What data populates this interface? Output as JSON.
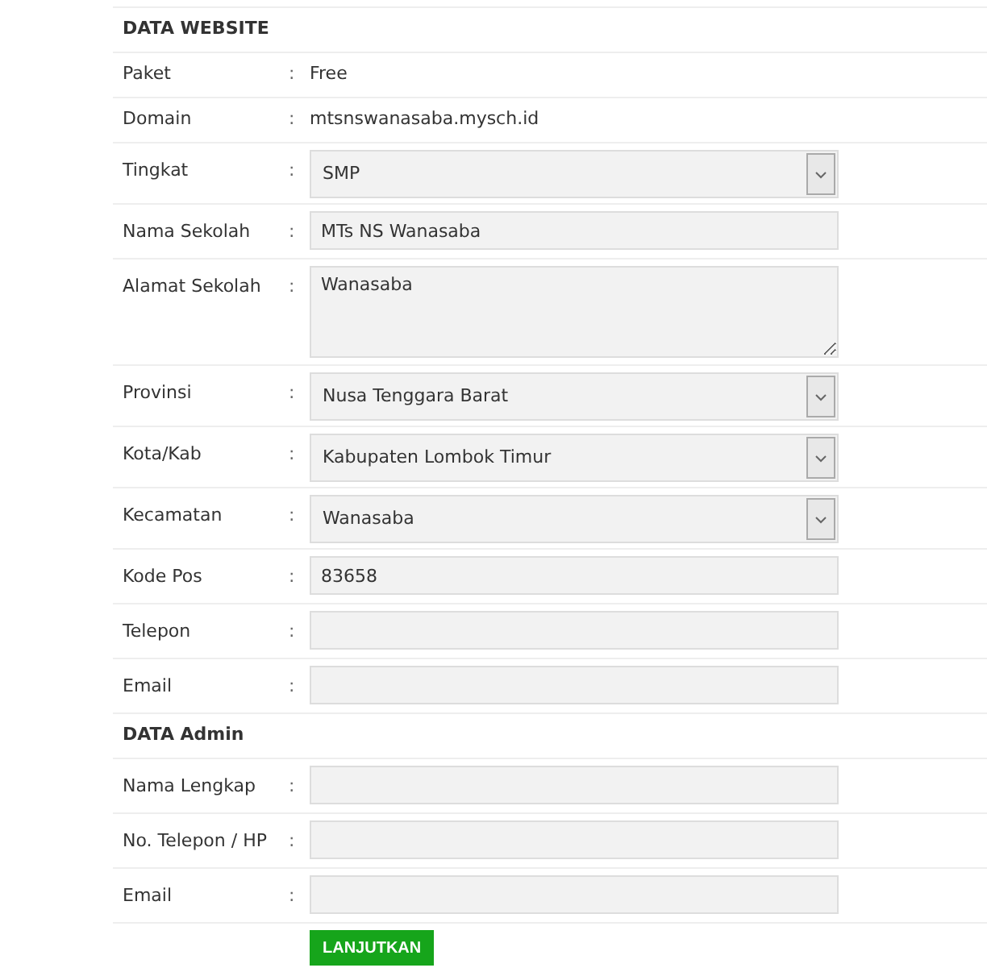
{
  "sections": [
    {
      "title": "DATA WEBSITE",
      "rows": [
        {
          "kind": "text",
          "label": "Paket",
          "separator": ":",
          "value": "Free"
        },
        {
          "kind": "text",
          "label": "Domain",
          "separator": ":",
          "value": "mtsnswanasaba.mysch.id"
        },
        {
          "kind": "select",
          "label": "Tingkat",
          "separator": ":",
          "value": "SMP"
        },
        {
          "kind": "input",
          "label": "Nama Sekolah",
          "separator": ":",
          "value": "MTs NS Wanasaba"
        },
        {
          "kind": "textarea",
          "label": "Alamat Sekolah",
          "separator": ":",
          "value": "Wanasaba"
        },
        {
          "kind": "select",
          "label": "Provinsi",
          "separator": ":",
          "value": "Nusa Tenggara Barat"
        },
        {
          "kind": "select",
          "label": "Kota/Kab",
          "separator": ":",
          "value": "Kabupaten Lombok Timur"
        },
        {
          "kind": "select",
          "label": "Kecamatan",
          "separator": ":",
          "value": "Wanasaba"
        },
        {
          "kind": "input",
          "label": "Kode Pos",
          "separator": ":",
          "value": "83658"
        },
        {
          "kind": "input",
          "label": "Telepon",
          "separator": ":"
        },
        {
          "kind": "input",
          "label": "Email",
          "separator": ":"
        }
      ]
    },
    {
      "title": "DATA Admin",
      "rows": [
        {
          "kind": "input",
          "label": "Nama Lengkap",
          "separator": ":"
        },
        {
          "kind": "input",
          "label": "No. Telepon / HP",
          "separator": ":"
        },
        {
          "kind": "input",
          "label": "Email",
          "separator": ":"
        }
      ]
    }
  ],
  "submit": "LANJUTKAN"
}
